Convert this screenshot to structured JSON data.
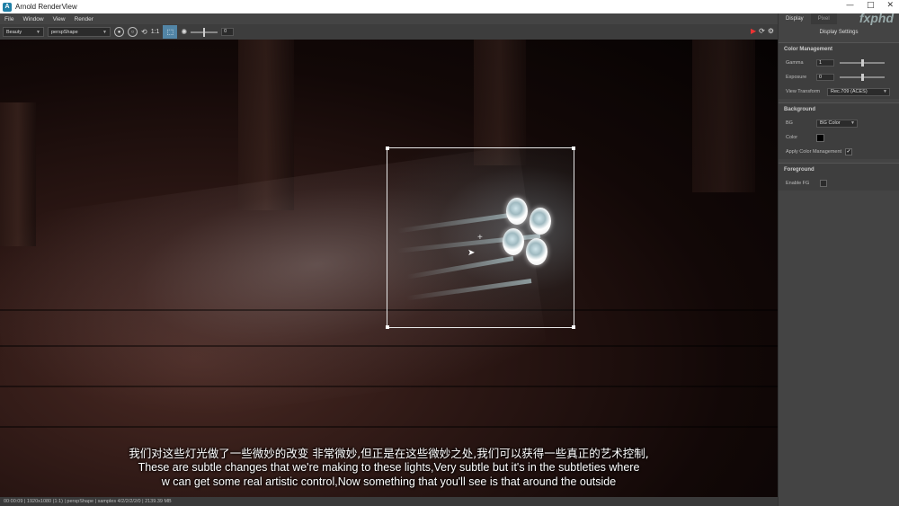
{
  "window": {
    "title": "Arnold RenderView",
    "controls": [
      "—",
      "□",
      "✕"
    ]
  },
  "menu": [
    "File",
    "Window",
    "View",
    "Render"
  ],
  "toolbar": {
    "aov": "Beauty",
    "camera": "perspShape",
    "ratio": "1:1",
    "exposure_field": "0"
  },
  "panel": {
    "tabs": [
      "Display",
      "Pixel"
    ],
    "watermark": "fxphd",
    "title": "Display Settings",
    "color_management": {
      "heading": "Color Management",
      "gamma_label": "Gamma",
      "gamma_value": "1",
      "gamma_level": 0.5,
      "exposure_label": "Exposure",
      "exposure_value": "0",
      "exposure_level": 0.5,
      "view_transform_label": "View Transform",
      "view_transform_value": "Rec.709 (ACES)"
    },
    "background": {
      "heading": "Background",
      "bg_label": "BG",
      "bg_value": "BG Color",
      "color_label": "Color",
      "color": "#000000",
      "apply_label": "Apply Color Management",
      "apply_checked": true
    },
    "foreground": {
      "heading": "Foreground",
      "enable_label": "Enable FG",
      "enable_checked": false
    }
  },
  "status": "00:00:09 | 1920x1080 (1:1) | perspShape | samples 4/2/2/2/2/0 | 2139.39 MB",
  "subtitles": {
    "cn": "我们对这些灯光做了一些微妙的改变 非常微妙,但正是在这些微妙之处,我们可以获得一些真正的艺术控制,",
    "en1": "These are subtle changes that we're making to these lights,Very subtle but it's in the subtleties where",
    "en2": "w can get some real artistic control,Now something that you'll see is that around the outside"
  }
}
